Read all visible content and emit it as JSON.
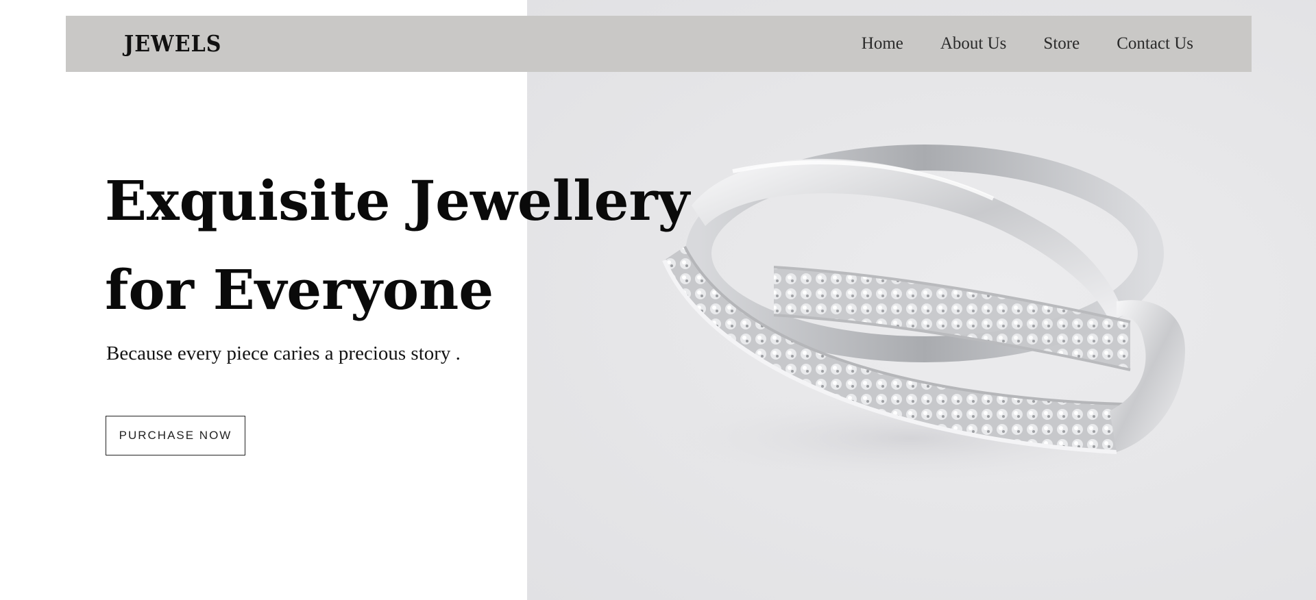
{
  "header": {
    "logo": "JEWELS",
    "nav": [
      {
        "label": "Home"
      },
      {
        "label": "About Us"
      },
      {
        "label": "Store"
      },
      {
        "label": "Contact Us"
      }
    ]
  },
  "hero": {
    "title_line1": "Exquisite Jewellery",
    "title_line2": "for Everyone",
    "subtitle": "Because every piece caries a precious story .",
    "cta_label": "PURCHASE NOW",
    "image": "diamond-ring-photo"
  },
  "colors": {
    "navbar_bg": "#c9c8c6",
    "hero_image_bg": "#e6e6e8",
    "text": "#0a0a0a",
    "page_bg": "#ffffff"
  }
}
